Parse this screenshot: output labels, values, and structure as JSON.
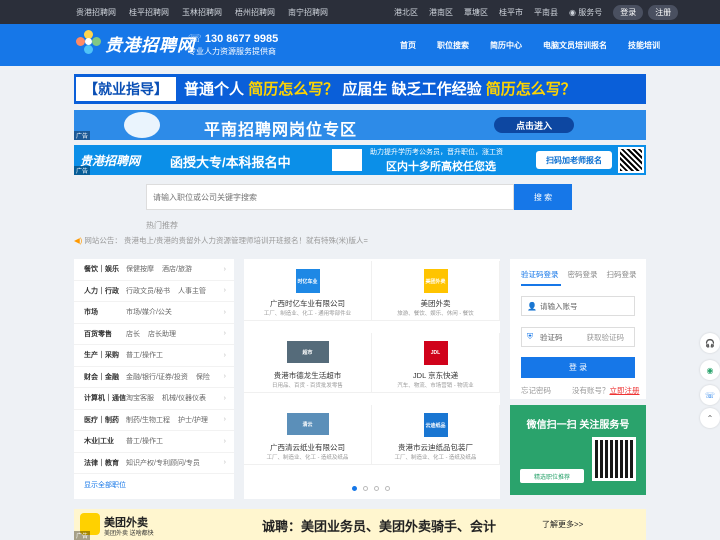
{
  "topbar": {
    "links": [
      "贵港招聘网",
      "桂平招聘网",
      "玉林招聘网",
      "梧州招聘网",
      "南宁招聘网"
    ],
    "regions": [
      "港北区",
      "港南区",
      "覃塘区",
      "桂平市",
      "平南县"
    ],
    "service": "服务号",
    "login": "登录",
    "register": "注册"
  },
  "header": {
    "logo": "贵港招聘网",
    "phone": "130 8677 9985",
    "slogan": "专业人力资源服务提供商",
    "nav": [
      "首页",
      "职位搜索",
      "简历中心",
      "电脑文员培训报名",
      "技能培训"
    ]
  },
  "banners": {
    "b1": {
      "a": "【就业指导】",
      "b": "普通个人",
      "c": "简历怎么写？",
      "d": "应届生",
      "e": "缺乏工作经验",
      "f": "简历怎么写？"
    },
    "b2": {
      "title": "平南招聘网岗位专区",
      "button": "点击进入",
      "ad": "广告"
    },
    "b3": {
      "logo": "贵港招聘网",
      "title": "函授大专/本科报名中",
      "sub1": "助力提升学历考公务员，晋升职位，涨工资",
      "sub2": "区内十多所高校任您选",
      "button": "扫码加老师报名",
      "ad": "广告"
    }
  },
  "search": {
    "placeholder": "请输入职位或公司关键字搜索",
    "button": "搜 索",
    "hot": "热门推荐"
  },
  "notice": {
    "label": "网站公告：",
    "text": "贵港电上/贵港的贵留外人力资源管理师培训开班报名！就有特殊(米)版人="
  },
  "categories": [
    {
      "name": "餐饮｜娱乐",
      "items": [
        "保健按摩",
        "酒店/旅游"
      ]
    },
    {
      "name": "人力｜行政",
      "items": [
        "行政文员/秘书",
        "人事主管"
      ]
    },
    {
      "name": "市场",
      "items": [
        "市场/媒介/公关"
      ]
    },
    {
      "name": "百货零售",
      "items": [
        "店长",
        "店长助理"
      ]
    },
    {
      "name": "生产｜采购",
      "items": [
        "普工/操作工"
      ]
    },
    {
      "name": "财会｜金融",
      "items": [
        "金融/银行/证券/投资",
        "保险"
      ]
    },
    {
      "name": "计算机｜通信",
      "items": [
        "淘宝客服",
        "机械/仪器仪表"
      ]
    },
    {
      "name": "医疗｜制药",
      "items": [
        "制药/生物工程",
        "护士/护理"
      ]
    },
    {
      "name": "木业|工业",
      "items": [
        "普工/操作工"
      ]
    },
    {
      "name": "法律｜教育",
      "items": [
        "知识产权/专利顾问/专员"
      ]
    }
  ],
  "cat_more": "显示全部职位",
  "companies": [
    {
      "name": "广西时亿车业有限公司",
      "tags": "工厂、制造业、化工 - 通用零部件业",
      "logo": "时亿车业",
      "color": "#1e88e5"
    },
    {
      "name": "美团外卖",
      "tags": "旅游、餐饮、娱乐、休闲 - 餐饮",
      "logo": "美团外卖",
      "color": "#ffc400"
    },
    {
      "name": "贵港市德龙生活超市",
      "tags": "日用品、百货 - 百货批发零售",
      "logo": "超市",
      "color": "#556b7a"
    },
    {
      "name": "JDL 京东快递",
      "tags": "汽车、物流、市场营销 - 物流业",
      "logo": "JDL",
      "color": "#d0021b"
    },
    {
      "name": "广西清云纸业有限公司",
      "tags": "工厂、制造业、化工 - 造纸及纸品",
      "logo": "清云",
      "color": "#5b8fb9"
    },
    {
      "name": "贵港市云迪纸品包装厂",
      "tags": "工厂、制造业、化工 - 造纸及纸品",
      "logo": "云迪纸品",
      "color": "#1976d2"
    }
  ],
  "login": {
    "tabs": [
      "验证码登录",
      "密码登录",
      "扫码登录"
    ],
    "phone": "请输入账号",
    "code": "验证码",
    "get_code": "获取验证码",
    "button": "登 录",
    "forgot": "忘记密码",
    "no_account": "没有账号？",
    "register": "立即注册"
  },
  "wechat": {
    "title": "微信扫一扫 关注服务号",
    "button": "精选职位推荐"
  },
  "bottom": {
    "brand": "美团外卖",
    "slogan": "美团外卖 送啥都快",
    "text": "诚聘：美团业务员、美团外卖骑手、会计",
    "more": "了解更多>>",
    "ad": "广告"
  }
}
